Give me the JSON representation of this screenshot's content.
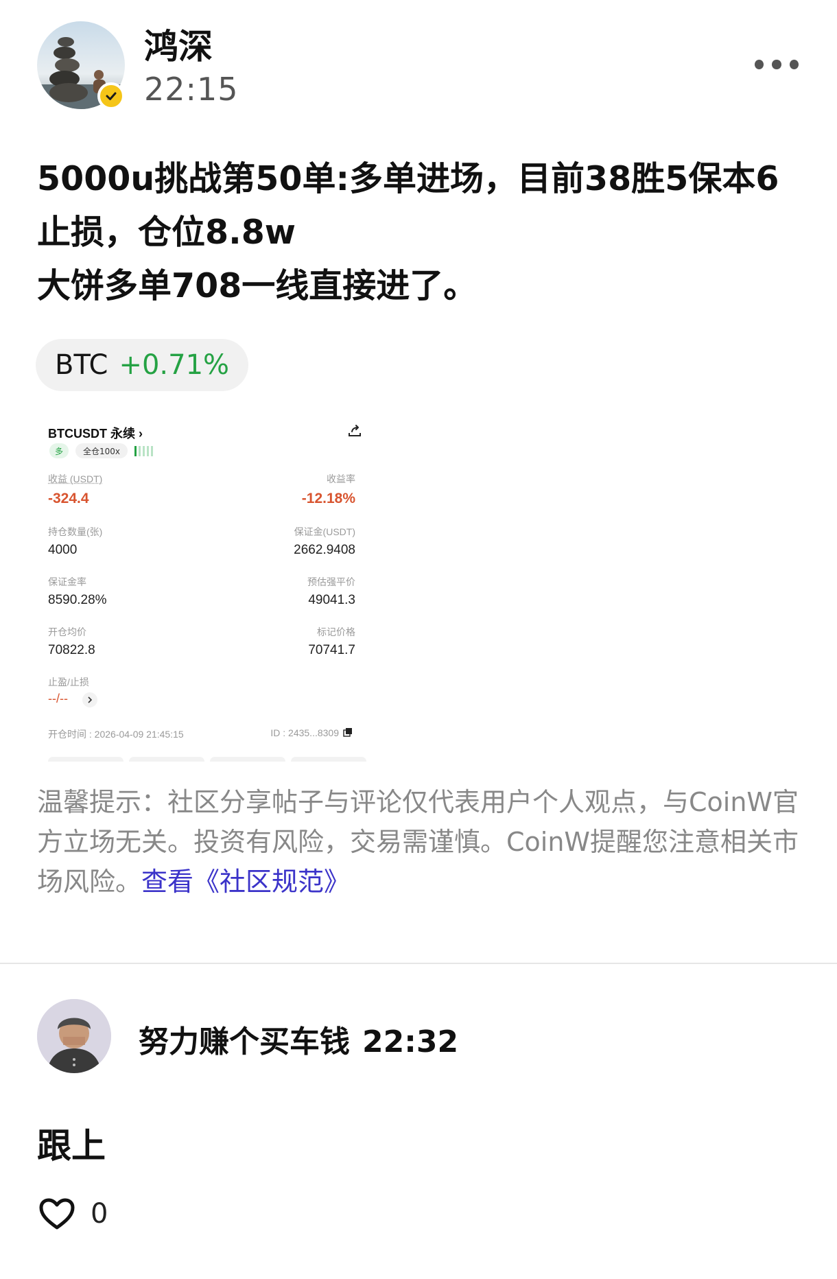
{
  "post": {
    "author": "鸿深",
    "time": "22:15",
    "text": "5000u挑战第50单:多单进场，目前38胜5保本6\n止损，仓位8.8w\n大饼多单708一线直接进了。",
    "ticker": {
      "symbol": "BTC",
      "change": "+0.71%"
    }
  },
  "card": {
    "pair": "BTCUSDT 永续 ›",
    "side": "多",
    "margin_mode": "全仓100x",
    "pnl_label": "收益 (USDT)",
    "pnl_value": "-324.4",
    "roi_label": "收益率",
    "roi_value": "-12.18%",
    "qty_label": "持仓数量(张)",
    "qty_value": "4000",
    "margin_label": "保证金(USDT)",
    "margin_value": "2662.9408",
    "margin_ratio_label": "保证金率",
    "margin_ratio_value": "8590.28%",
    "liq_label": "预估强平价",
    "liq_value": "49041.3",
    "entry_label": "开仓均价",
    "entry_value": "70822.8",
    "mark_label": "标记价格",
    "mark_value": "70741.7",
    "tpsl_label": "止盈/止损",
    "tpsl_value": "--/--",
    "open_time": "开仓时间 : 2026-04-09 21:45:15",
    "id": "ID : 2435...8309"
  },
  "disclaimer": {
    "text": "温馨提示：社区分享帖子与评论仅代表用户个人观点，与CoinW官方立场无关。投资有风险，交易需谨慎。CoinW提醒您注意相关市场风险。",
    "link": "查看《社区规范》"
  },
  "comment": {
    "name": "努力赚个买车钱",
    "time": "22:32",
    "text": "跟上",
    "likes": "0"
  },
  "colors": {
    "positive": "#25a244",
    "negative": "#d8542f",
    "link": "#3b33c9"
  },
  "icons": {
    "more": "more-dots-icon",
    "verified": "verified-check-icon",
    "share": "share-icon",
    "copy": "copy-icon",
    "like": "heart-icon"
  }
}
